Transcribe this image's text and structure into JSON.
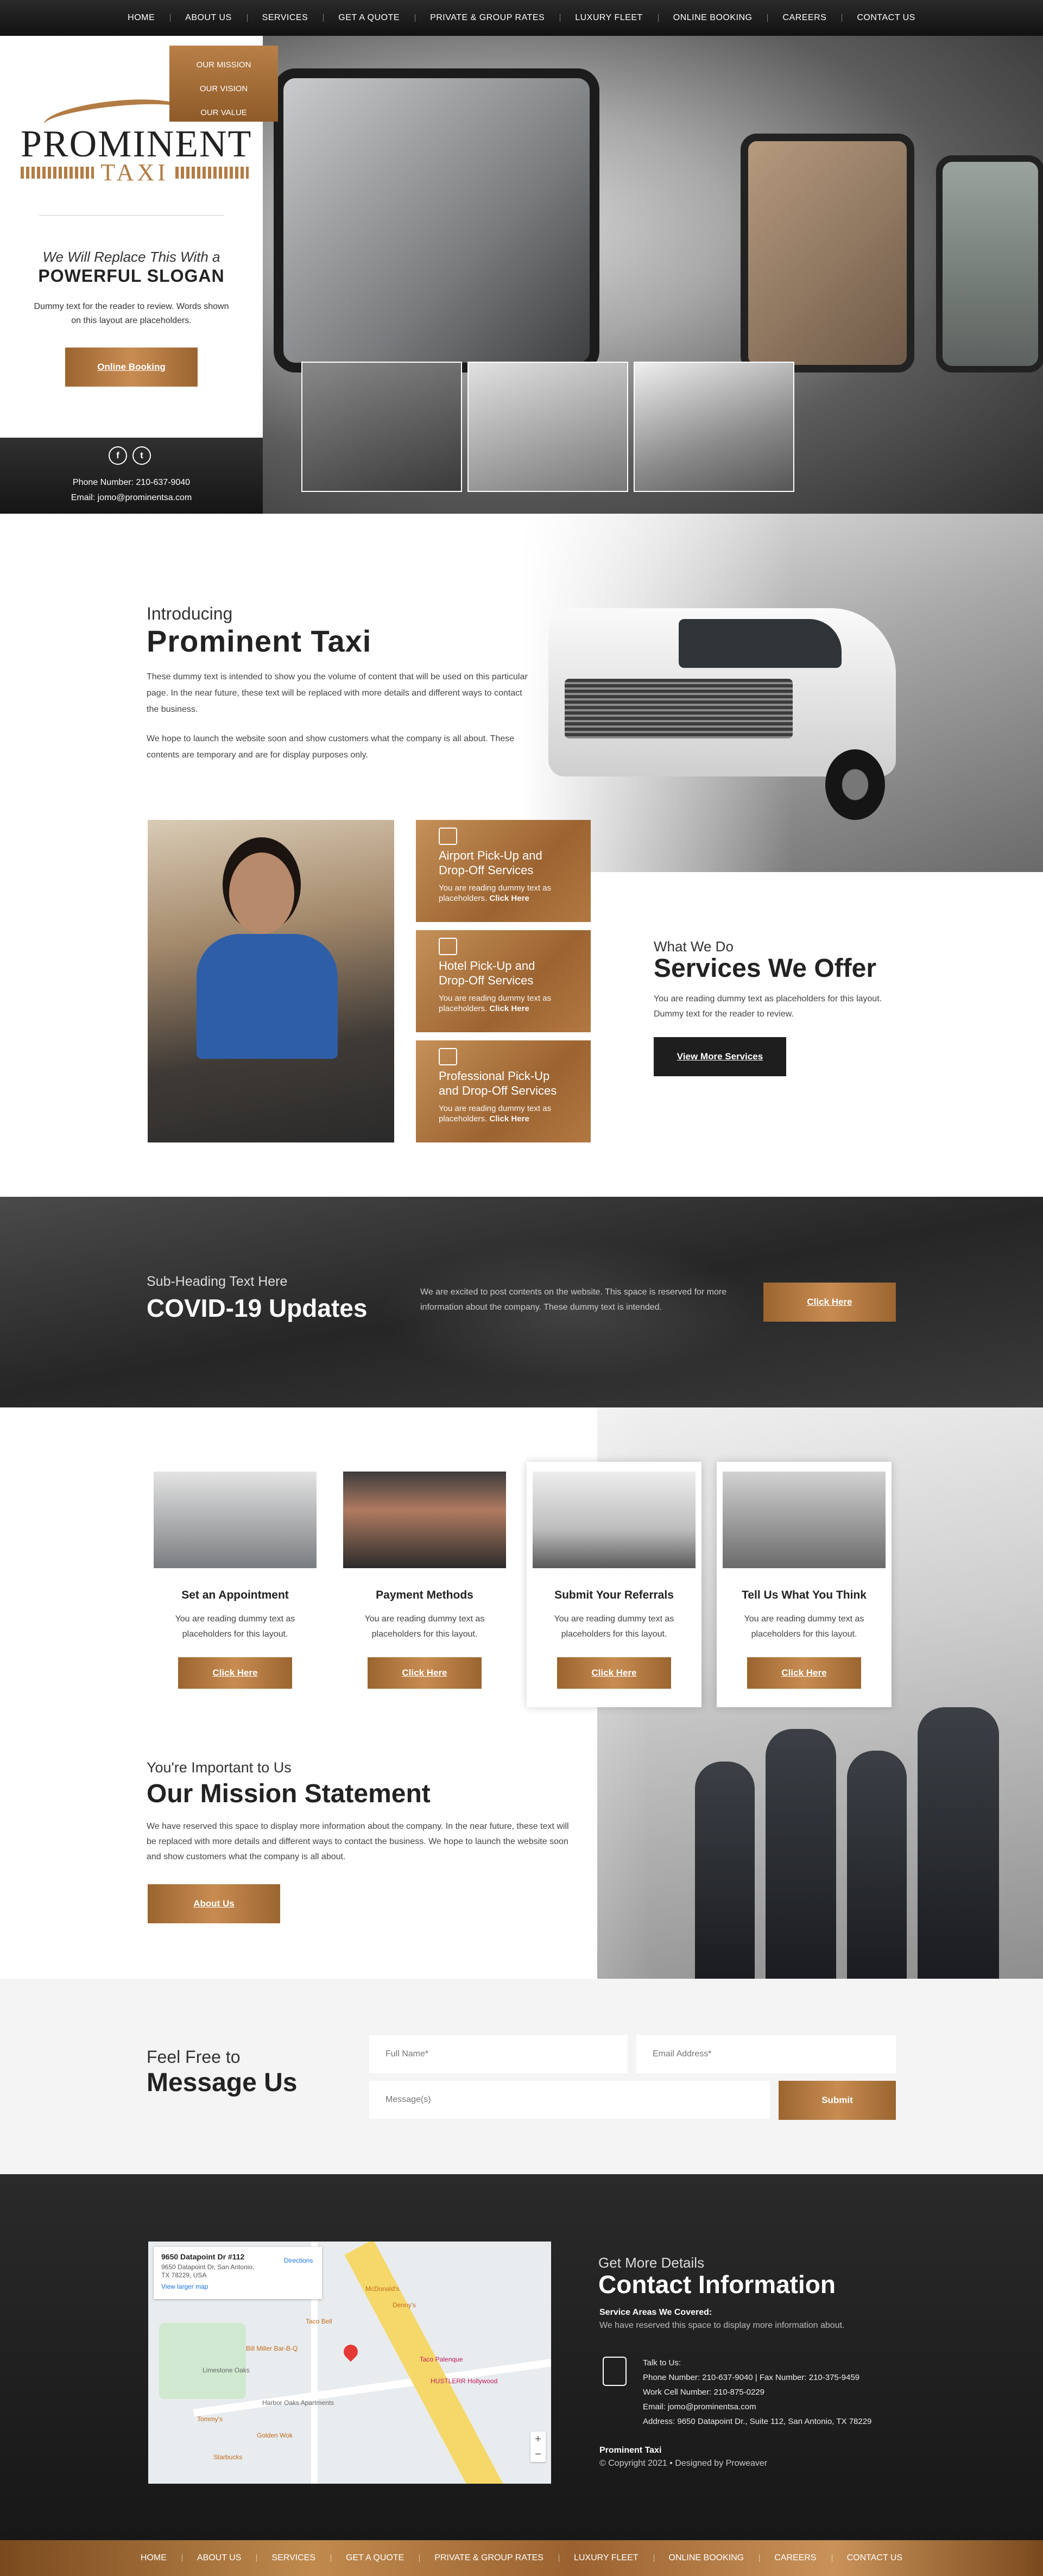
{
  "nav": {
    "items": [
      "HOME",
      "ABOUT US",
      "SERVICES",
      "GET A QUOTE",
      "PRIVATE & GROUP RATES",
      "LUXURY FLEET",
      "ONLINE BOOKING",
      "CAREERS",
      "CONTACT US"
    ]
  },
  "hero": {
    "dropdown": [
      "OUR MISSION",
      "OUR VISION",
      "OUR VALUE"
    ],
    "logo": {
      "word": "PROMINENT",
      "sub": "TAXI"
    },
    "slogan_line1": "We Will Replace This With a",
    "slogan_line2": "POWERFUL SLOGAN",
    "slogan_text": "Dummy text for the reader to review. Words shown on this layout are placeholders.",
    "button": "Online Booking",
    "social": [
      "f",
      "t"
    ],
    "phone": "Phone Number: 210-637-9040",
    "email": "Email: jomo@prominentsa.com"
  },
  "intro": {
    "subtitle": "Introducing",
    "title": "Prominent Taxi",
    "p1": "These dummy text is intended to show you the volume of content that will be used on this particular page. In the near future, these text will be replaced with more details and different ways to contact the business.",
    "p2": "We hope to launch the website soon and show customers what the company is all about. These contents are temporary and are for display purposes only."
  },
  "services": {
    "cards": [
      {
        "title": "Airport Pick-Up and Drop-Off Services",
        "text": "You are reading dummy text as placeholders.",
        "link": "Click Here"
      },
      {
        "title": "Hotel Pick-Up and Drop-Off Services",
        "text": "You are reading dummy text as placeholders.",
        "link": "Click Here"
      },
      {
        "title": "Professional Pick-Up and Drop-Off Services",
        "text": "You are reading dummy text as placeholders.",
        "link": "Click Here"
      }
    ],
    "subtitle": "What We Do",
    "title": "Services We Offer",
    "text": "You are reading dummy text as placeholders for this layout. Dummy text for the reader to review.",
    "button": "View More Services"
  },
  "covid": {
    "subtitle": "Sub-Heading Text Here",
    "title": "COVID-19 Updates",
    "text": "We are excited to post contents on the website. This space is reserved for more information about the company. These dummy text is intended.",
    "button": "Click Here"
  },
  "features": [
    {
      "title": "Set an Appointment",
      "text": "You are reading dummy text as placeholders for this layout.",
      "button": "Click Here"
    },
    {
      "title": "Payment Methods",
      "text": "You are reading dummy text as placeholders for this layout.",
      "button": "Click Here"
    },
    {
      "title": "Submit Your Referrals",
      "text": "You are reading dummy text as placeholders for this layout.",
      "button": "Click Here"
    },
    {
      "title": "Tell Us What You Think",
      "text": "You are reading dummy text as placeholders for this layout.",
      "button": "Click Here"
    }
  ],
  "mission": {
    "subtitle": "You're Important to Us",
    "title": "Our Mission Statement",
    "text": "We have reserved this space to display more information about the company. In the near future, these text will be replaced with more details and different ways to contact the business. We hope to launch the website soon and show customers what the company is all about.",
    "button": "About Us"
  },
  "message": {
    "subtitle": "Feel Free to",
    "title": "Message Us",
    "name_placeholder": "Full Name*",
    "email_placeholder": "Email Address*",
    "message_placeholder": "Message(s)",
    "button": "Submit"
  },
  "footer": {
    "map": {
      "place": "9650 Datapoint Dr #112",
      "address": "9650 Datapoint Dr, San Antonio, TX 78229, USA",
      "larger": "View larger map",
      "directions": "Directions",
      "labels": [
        "McDonald's",
        "Denny's",
        "Taco Bell",
        "Bill Miller Bar-B-Q",
        "Limestone Oaks",
        "Harbor Oaks Apartments",
        "Tommy's",
        "Starbucks",
        "Golden Wok",
        "HUSTLERR Hollywood",
        "Taco Palenque"
      ]
    },
    "subtitle": "Get More Details",
    "title": "Contact Information",
    "areas_heading": "Service Areas We Covered:",
    "areas_text": "We have reserved this space to display more information about.",
    "contact_lines": [
      "Talk to Us:",
      "Phone Number: 210-637-9040 | Fax Number: 210-375-9459",
      "Work Cell Number: 210-875-0229",
      "Email: jomo@prominentsa.com",
      "Address: 9650 Datapoint Dr., Suite 112, San Antonio, TX 78229"
    ],
    "brand": "Prominent Taxi",
    "copyright": "© Copyright 2021 • Designed by Proweaver"
  },
  "colors": {
    "gold": "#b27c45",
    "dark": "#1e1e1e"
  }
}
